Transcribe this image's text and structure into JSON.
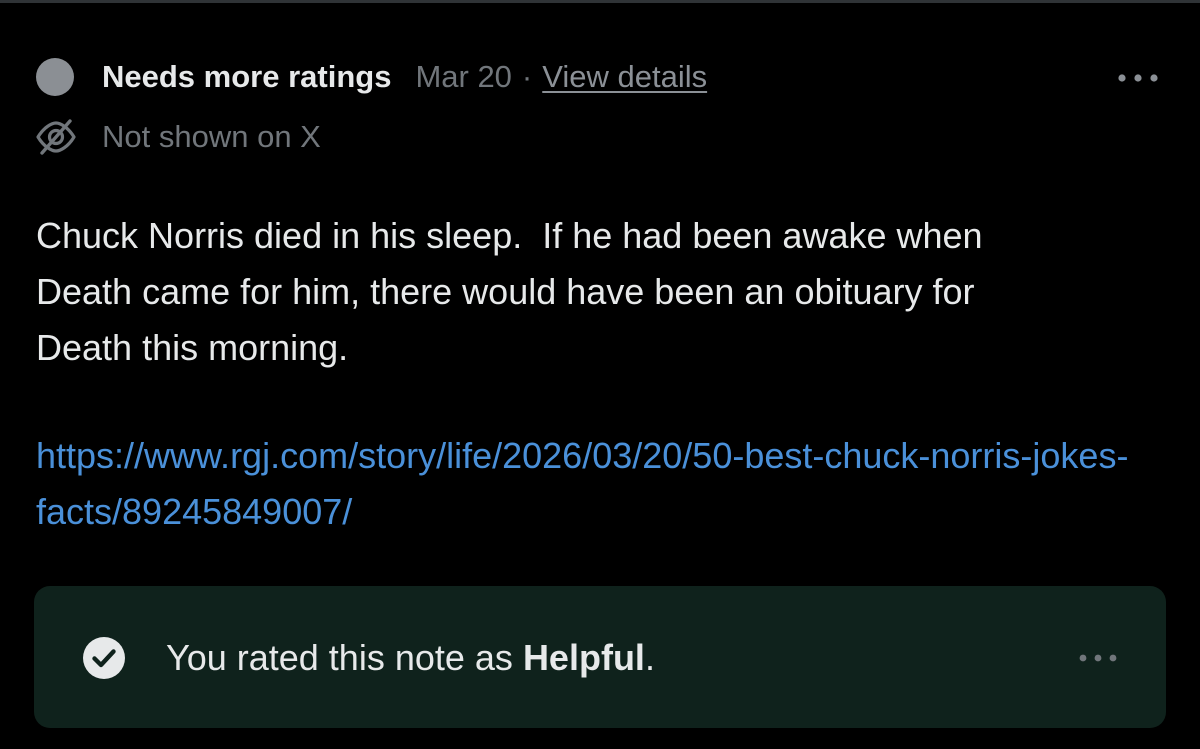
{
  "note": {
    "status_label": "Needs more ratings",
    "date": "Mar 20",
    "separator": "·",
    "view_details_label": "View details",
    "visibility_text": "Not shown on X",
    "body": "Chuck Norris died in his sleep.  If he had been awake when\nDeath came for him, there would have been an obituary for\nDeath this morning.",
    "link": "https://www.rgj.com/story/life/2026/03/20/50-best-chuck-norris-jokes-facts/89245849007/",
    "more_icon": "more-horizontal-icon",
    "status_icon": "status-dot-icon",
    "visibility_icon": "eye-off-icon"
  },
  "rating": {
    "prefix": "You rated this note as ",
    "value": "Helpful",
    "suffix": ".",
    "check_icon": "check-circle-icon",
    "more_icon": "more-horizontal-icon"
  },
  "colors": {
    "background": "#000000",
    "primary_text": "#e7e9ea",
    "secondary_text": "#71767b",
    "link": "#4a90d9",
    "rating_background": "#0f221c",
    "status_dot": "#8b8f94"
  }
}
